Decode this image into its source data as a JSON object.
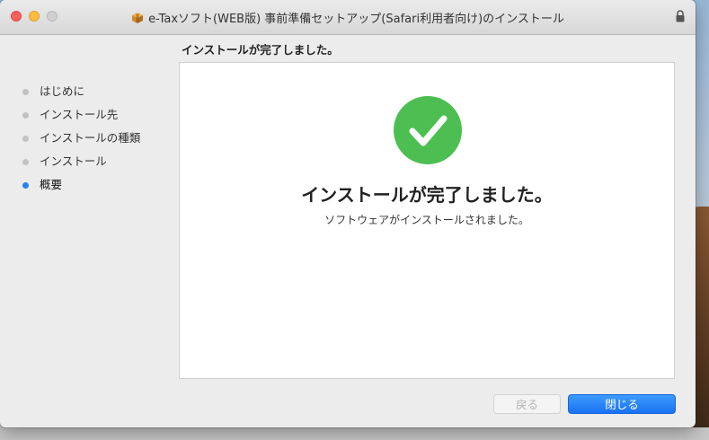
{
  "window": {
    "title": "e-Taxソフト(WEB版) 事前準備セットアップ(Safari利用者向け)のインストール"
  },
  "icons": {
    "app": "package-icon",
    "lock": "lock-icon",
    "success": "checkmark-circle-icon"
  },
  "colors": {
    "accent": "#1a72f2",
    "success": "#4dbf52",
    "active_step": "#2a7ef0",
    "inactive_step": "#c2c2c2"
  },
  "sidebar": {
    "steps": [
      {
        "label": "はじめに",
        "active": false
      },
      {
        "label": "インストール先",
        "active": false
      },
      {
        "label": "インストールの種類",
        "active": false
      },
      {
        "label": "インストール",
        "active": false
      },
      {
        "label": "概要",
        "active": true
      }
    ]
  },
  "main": {
    "heading": "インストールが完了しました。",
    "completion_title": "インストールが完了しました。",
    "completion_message": "ソフトウェアがインストールされました。"
  },
  "buttons": {
    "back_label": "戻る",
    "back_enabled": false,
    "close_label": "閉じる"
  }
}
